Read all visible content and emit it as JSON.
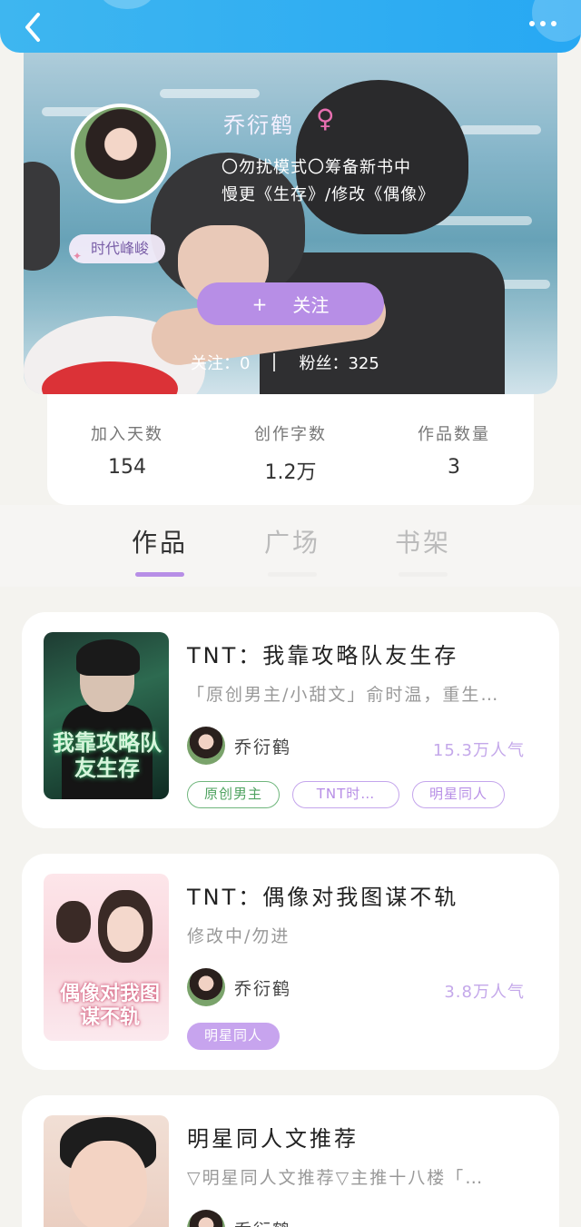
{
  "header": {
    "back_icon": "chevron-left-icon",
    "more_icon": "more-dots-icon",
    "bar_color": "#2fadf2"
  },
  "profile": {
    "name": "乔衍鹤",
    "gender_symbol": "♀",
    "bio_line1": "〇勿扰模式〇筹备新书中",
    "bio_line2": "慢更《生存》/修改《偶像》",
    "badge": "时代峰峻",
    "follow_label": "关注",
    "follow_plus": "+",
    "following": "关注：0",
    "followers": "粉丝：325",
    "accent_color": "#b78ee6"
  },
  "stats": [
    {
      "label": "加入天数",
      "value": "154"
    },
    {
      "label": "创作字数",
      "value": "1.2万"
    },
    {
      "label": "作品数量",
      "value": "3"
    }
  ],
  "tabs": [
    {
      "label": "作品",
      "active": true
    },
    {
      "label": "广场",
      "active": false
    },
    {
      "label": "书架",
      "active": false
    }
  ],
  "works": [
    {
      "title": "TNT：我靠攻略队友生存",
      "description": "「原创男主/小甜文」俞时温，重生…",
      "author": "乔衍鹤",
      "popularity": "15.3万人气",
      "cover_text": "我靠攻略队友生存",
      "tags": [
        {
          "label": "原创男主",
          "style": "green"
        },
        {
          "label": "TNT时…",
          "style": "purple"
        },
        {
          "label": "明星同人",
          "style": "purple"
        }
      ]
    },
    {
      "title": "TNT：偶像对我图谋不轨",
      "description": "修改中/勿进",
      "author": "乔衍鹤",
      "popularity": "3.8万人气",
      "cover_text": "偶像对我图谋不轨",
      "tags": [
        {
          "label": "明星同人",
          "style": "filled"
        }
      ]
    },
    {
      "title": "明星同人文推荐",
      "description": "▽明星同人文推荐▽主推十八楼「…",
      "author": "乔衍鹤",
      "popularity": "",
      "cover_text": "",
      "tags": []
    }
  ]
}
